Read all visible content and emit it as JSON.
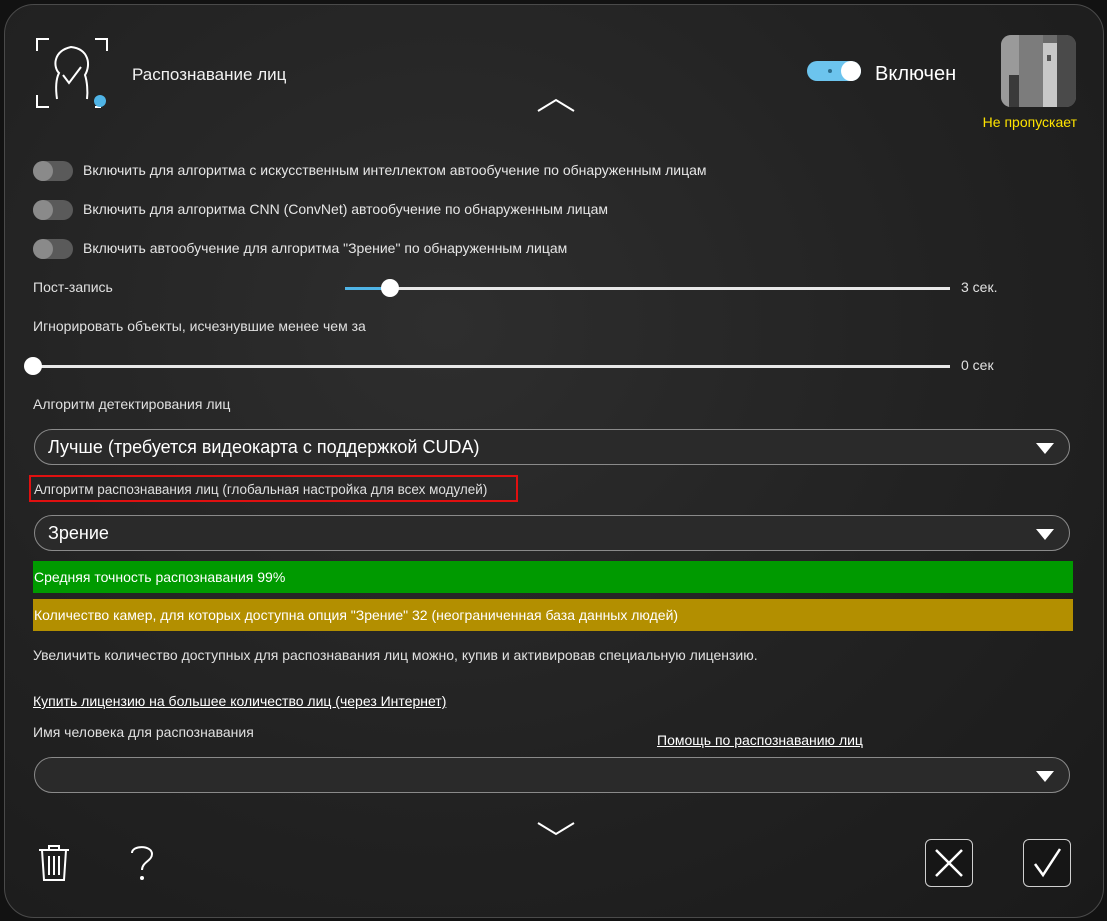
{
  "header": {
    "title": "Распознавание лиц",
    "enabled_label": "Включен",
    "camera_status": "Не пропускает"
  },
  "options": [
    {
      "label": "Включить для алгоритма с искусственным интеллектом автообучение по обнаруженным лицам",
      "on": false
    },
    {
      "label": "Включить для алгоритма CNN (ConvNet) автообучение по обнаруженным лицам",
      "on": false
    },
    {
      "label": "Включить автообучение для алгоритма \"Зрение\" по обнаруженным лицам",
      "on": false
    }
  ],
  "post_record": {
    "label": "Пост-запись",
    "value_text": "3 сек.",
    "fraction": 0.07
  },
  "ignore_objects": {
    "label": "Игнорировать объекты, исчезнувшие менее чем за",
    "value_text": "0 сек",
    "fraction": 0.0
  },
  "detection": {
    "label": "Алгоритм детектирования лиц",
    "selected": "Лучше (требуется видеокарта с поддержкой CUDA)"
  },
  "recognition": {
    "label": "Алгоритм распознавания лиц (глобальная настройка для всех модулей)",
    "selected": "Зрение"
  },
  "info_bars": {
    "accuracy": "Средняя точность распознавания 99%",
    "cameras": "Количество камер, для которых доступна опция \"Зрение\" 32 (неограниченная база данных людей)",
    "accuracy_color": "#009a00",
    "cameras_color": "#b38f00"
  },
  "license_note": "Увеличить количество доступных для распознавания лиц можно, купив и активировав специальную лицензию.",
  "buy_link": "Купить лицензию на большее количество лиц (через Интернет)",
  "person_name": {
    "label": "Имя человека для распознавания",
    "selected": ""
  },
  "help_link": "Помощь по распознаванию лиц",
  "colors": {
    "accent": "#6cc4ee",
    "status_yellow": "#ffe400",
    "highlight_red": "#e01010"
  }
}
